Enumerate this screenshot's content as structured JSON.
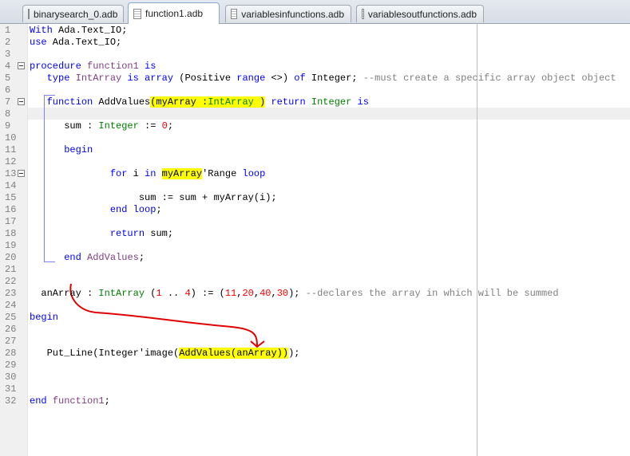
{
  "tabs": [
    {
      "label": "binarysearch_0.adb",
      "active": false
    },
    {
      "label": "function1.adb",
      "active": true
    },
    {
      "label": "variablesinfunctions.adb",
      "active": false
    },
    {
      "label": "variablesoutfunctions.adb",
      "active": false
    }
  ],
  "lines": [
    [
      [
        "With",
        "kw"
      ],
      [
        " Ada.Text_IO;",
        ""
      ]
    ],
    [
      [
        "use",
        "kw"
      ],
      [
        " Ada.Text_IO;",
        ""
      ]
    ],
    [],
    [
      [
        "procedure",
        "kw"
      ],
      [
        " ",
        ""
      ],
      [
        "function1",
        "id"
      ],
      [
        " ",
        ""
      ],
      [
        "is",
        "kw"
      ]
    ],
    [
      [
        "   ",
        ""
      ],
      [
        "type",
        "kw"
      ],
      [
        " ",
        ""
      ],
      [
        "IntArray",
        "id"
      ],
      [
        " ",
        ""
      ],
      [
        "is array",
        "kw"
      ],
      [
        " (Positive ",
        ""
      ],
      [
        "range",
        "kw"
      ],
      [
        " <>) ",
        ""
      ],
      [
        "of",
        "kw"
      ],
      [
        " Integer; ",
        ""
      ],
      [
        "--must create a specific array object object",
        "cm"
      ]
    ],
    [],
    [
      [
        "   ",
        ""
      ],
      [
        "function",
        "kw"
      ],
      [
        " AddValues",
        ""
      ],
      [
        "(myArray :",
        "hl"
      ],
      [
        "IntArray",
        "ty hl"
      ],
      [
        " )",
        "hl"
      ],
      [
        " ",
        ""
      ],
      [
        "return",
        "kw"
      ],
      [
        " ",
        ""
      ],
      [
        "Integer",
        "ty"
      ],
      [
        " ",
        ""
      ],
      [
        "is",
        "kw"
      ]
    ],
    [],
    [
      [
        "      sum : ",
        ""
      ],
      [
        "Integer",
        "ty"
      ],
      [
        " := ",
        ""
      ],
      [
        "0",
        "nu"
      ],
      [
        ";",
        ""
      ]
    ],
    [],
    [
      [
        "      ",
        ""
      ],
      [
        "begin",
        "kw"
      ]
    ],
    [],
    [
      [
        "              ",
        ""
      ],
      [
        "for",
        "kw"
      ],
      [
        " i ",
        ""
      ],
      [
        "in",
        "kw"
      ],
      [
        " ",
        ""
      ],
      [
        "myArray",
        "hl"
      ],
      [
        "'Range ",
        ""
      ],
      [
        "loop",
        "kw"
      ]
    ],
    [],
    [
      [
        "                   sum := sum + myArray(i);",
        ""
      ]
    ],
    [
      [
        "              ",
        ""
      ],
      [
        "end loop",
        "kw"
      ],
      [
        ";",
        ""
      ]
    ],
    [],
    [
      [
        "              ",
        ""
      ],
      [
        "return",
        "kw"
      ],
      [
        " sum;",
        ""
      ]
    ],
    [],
    [
      [
        "      ",
        ""
      ],
      [
        "end",
        "kw"
      ],
      [
        " ",
        ""
      ],
      [
        "AddValues",
        "id"
      ],
      [
        ";",
        ""
      ]
    ],
    [],
    [],
    [
      [
        "  anArray : ",
        ""
      ],
      [
        "IntArray",
        "ty"
      ],
      [
        " (",
        ""
      ],
      [
        "1",
        "nu"
      ],
      [
        " .. ",
        ""
      ],
      [
        "4",
        "nu"
      ],
      [
        ") := (",
        ""
      ],
      [
        "11",
        "nu"
      ],
      [
        ",",
        ""
      ],
      [
        "20",
        "nu"
      ],
      [
        ",",
        ""
      ],
      [
        "40",
        "nu"
      ],
      [
        ",",
        ""
      ],
      [
        "30",
        "nu"
      ],
      [
        "); ",
        ""
      ],
      [
        "--declares the array in which will be summed",
        "cm"
      ]
    ],
    [],
    [
      [
        "begin",
        "kw"
      ]
    ],
    [],
    [],
    [
      [
        "   Put_Line(Integer'image(",
        ""
      ],
      [
        "AddValues(anArray))",
        "hl"
      ],
      [
        ");",
        ""
      ]
    ],
    [],
    [],
    [],
    [
      [
        "end",
        "kw"
      ],
      [
        " ",
        ""
      ],
      [
        "function1",
        "id"
      ],
      [
        ";",
        ""
      ]
    ]
  ],
  "folds": [
    4,
    7,
    13
  ],
  "current_line": 8
}
